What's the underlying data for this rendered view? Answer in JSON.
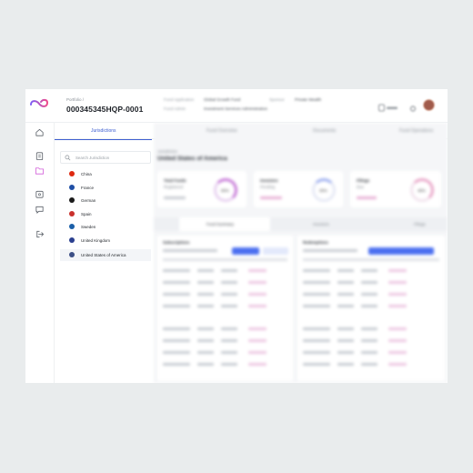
{
  "header": {
    "breadcrumb": "Portfolio /",
    "application_id": "000345345HQP-0001",
    "meta_1_label": "Fund Application",
    "meta_1_value": "Global Growth Fund",
    "meta_2_label": "Sponsor",
    "meta_2_value": "Private Wealth",
    "meta_3_label": "Fund Admin",
    "meta_3_value": "Investment Services Administration",
    "notify_label": "Alerts"
  },
  "panel": {
    "tab_label": "Jurisdictions",
    "search_placeholder": "Search Jurisdiction"
  },
  "countries": [
    {
      "name": "China",
      "flag_color": "#de2910",
      "active": false
    },
    {
      "name": "France",
      "flag_color": "#1f4fa5",
      "active": false
    },
    {
      "name": "German",
      "flag_color": "#1a1a1a",
      "active": false
    },
    {
      "name": "Spain",
      "flag_color": "#c9302c",
      "active": false
    },
    {
      "name": "Sweden",
      "flag_color": "#1b5fa8",
      "active": false
    },
    {
      "name": "United Kingdom",
      "flag_color": "#2a3f8f",
      "active": false
    },
    {
      "name": "United States of America",
      "flag_color": "#3c4f86",
      "active": true
    }
  ],
  "main": {
    "top_tabs": [
      "Fund Overview",
      "Documents",
      "Fund Operations"
    ],
    "section_label": "Jurisdiction",
    "section_title": "United States of America",
    "cards": [
      {
        "title": "Total Funds",
        "sub": "Registered",
        "value": "80%",
        "ring_color": "#c77ad8"
      },
      {
        "title": "Investors",
        "sub": "Pending",
        "value": "30%",
        "ring_color": "#9fb0f0"
      },
      {
        "title": "Filings",
        "sub": "Due",
        "value": "48%",
        "ring_color": "#e9a7c9"
      }
    ],
    "sub_tabs": [
      "Fund Summary",
      "Investors",
      "Filings"
    ],
    "tables": [
      {
        "title": "Subscriptions",
        "button": "Export"
      },
      {
        "title": "Redemptions",
        "button": "Export"
      }
    ]
  },
  "colors": {
    "accent": "#3e5fd1",
    "logo_start": "#8a5cf6",
    "logo_end": "#e94a8c"
  }
}
